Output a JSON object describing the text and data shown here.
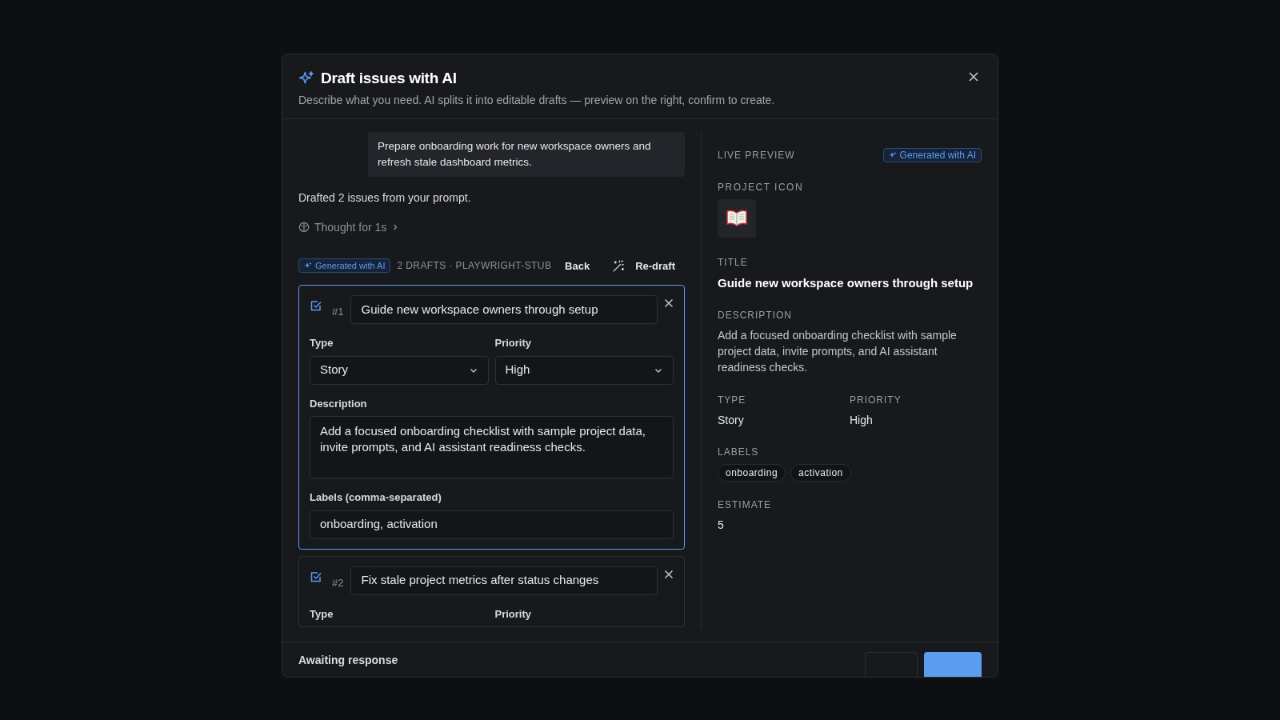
{
  "dialog": {
    "title": "Draft issues with AI",
    "subtitle": "Describe what you need. AI splits it into editable drafts — preview on the right, confirm to create."
  },
  "conversation": {
    "prompt": "Prepare onboarding work for new workspace owners and refresh stale dashboard metrics.",
    "reply": "Drafted 2 issues from your prompt.",
    "thought": "Thought for 1s",
    "expanded": false
  },
  "toolbar": {
    "badge": "Generated with AI",
    "summary": "2 DRAFTS · PLAYWRIGHT-STUB",
    "back": "Back",
    "redraft": "Re-draft"
  },
  "drafts": [
    {
      "number": "#1",
      "checked": true,
      "selected": true,
      "title": "Guide new workspace owners through setup",
      "type": {
        "label": "Type",
        "value": "Story"
      },
      "priority": {
        "label": "Priority",
        "value": "High"
      },
      "description": {
        "label": "Description",
        "value": "Add a focused onboarding checklist with sample project data, invite prompts, and AI assistant readiness checks."
      },
      "labels": {
        "label": "Labels (comma-separated)",
        "value": "onboarding, activation"
      }
    },
    {
      "number": "#2",
      "checked": true,
      "selected": false,
      "title": "Fix stale project metrics after status changes",
      "type": {
        "label": "Type"
      },
      "priority": {
        "label": "Priority"
      }
    }
  ],
  "preview": {
    "heading": "LIVE PREVIEW",
    "badge": "Generated with AI",
    "icon_label": "PROJECT ICON",
    "title_label": "TITLE",
    "title": "Guide new workspace owners through setup",
    "description_label": "DESCRIPTION",
    "description": "Add a focused onboarding checklist with sample project data, invite prompts, and AI assistant readiness checks.",
    "type_label": "TYPE",
    "type": "Story",
    "priority_label": "PRIORITY",
    "priority": "High",
    "labels_label": "LABELS",
    "labels": [
      "onboarding",
      "activation"
    ],
    "estimate_label": "ESTIMATE",
    "estimate": "5"
  },
  "footer": {
    "status": "Awaiting response"
  }
}
